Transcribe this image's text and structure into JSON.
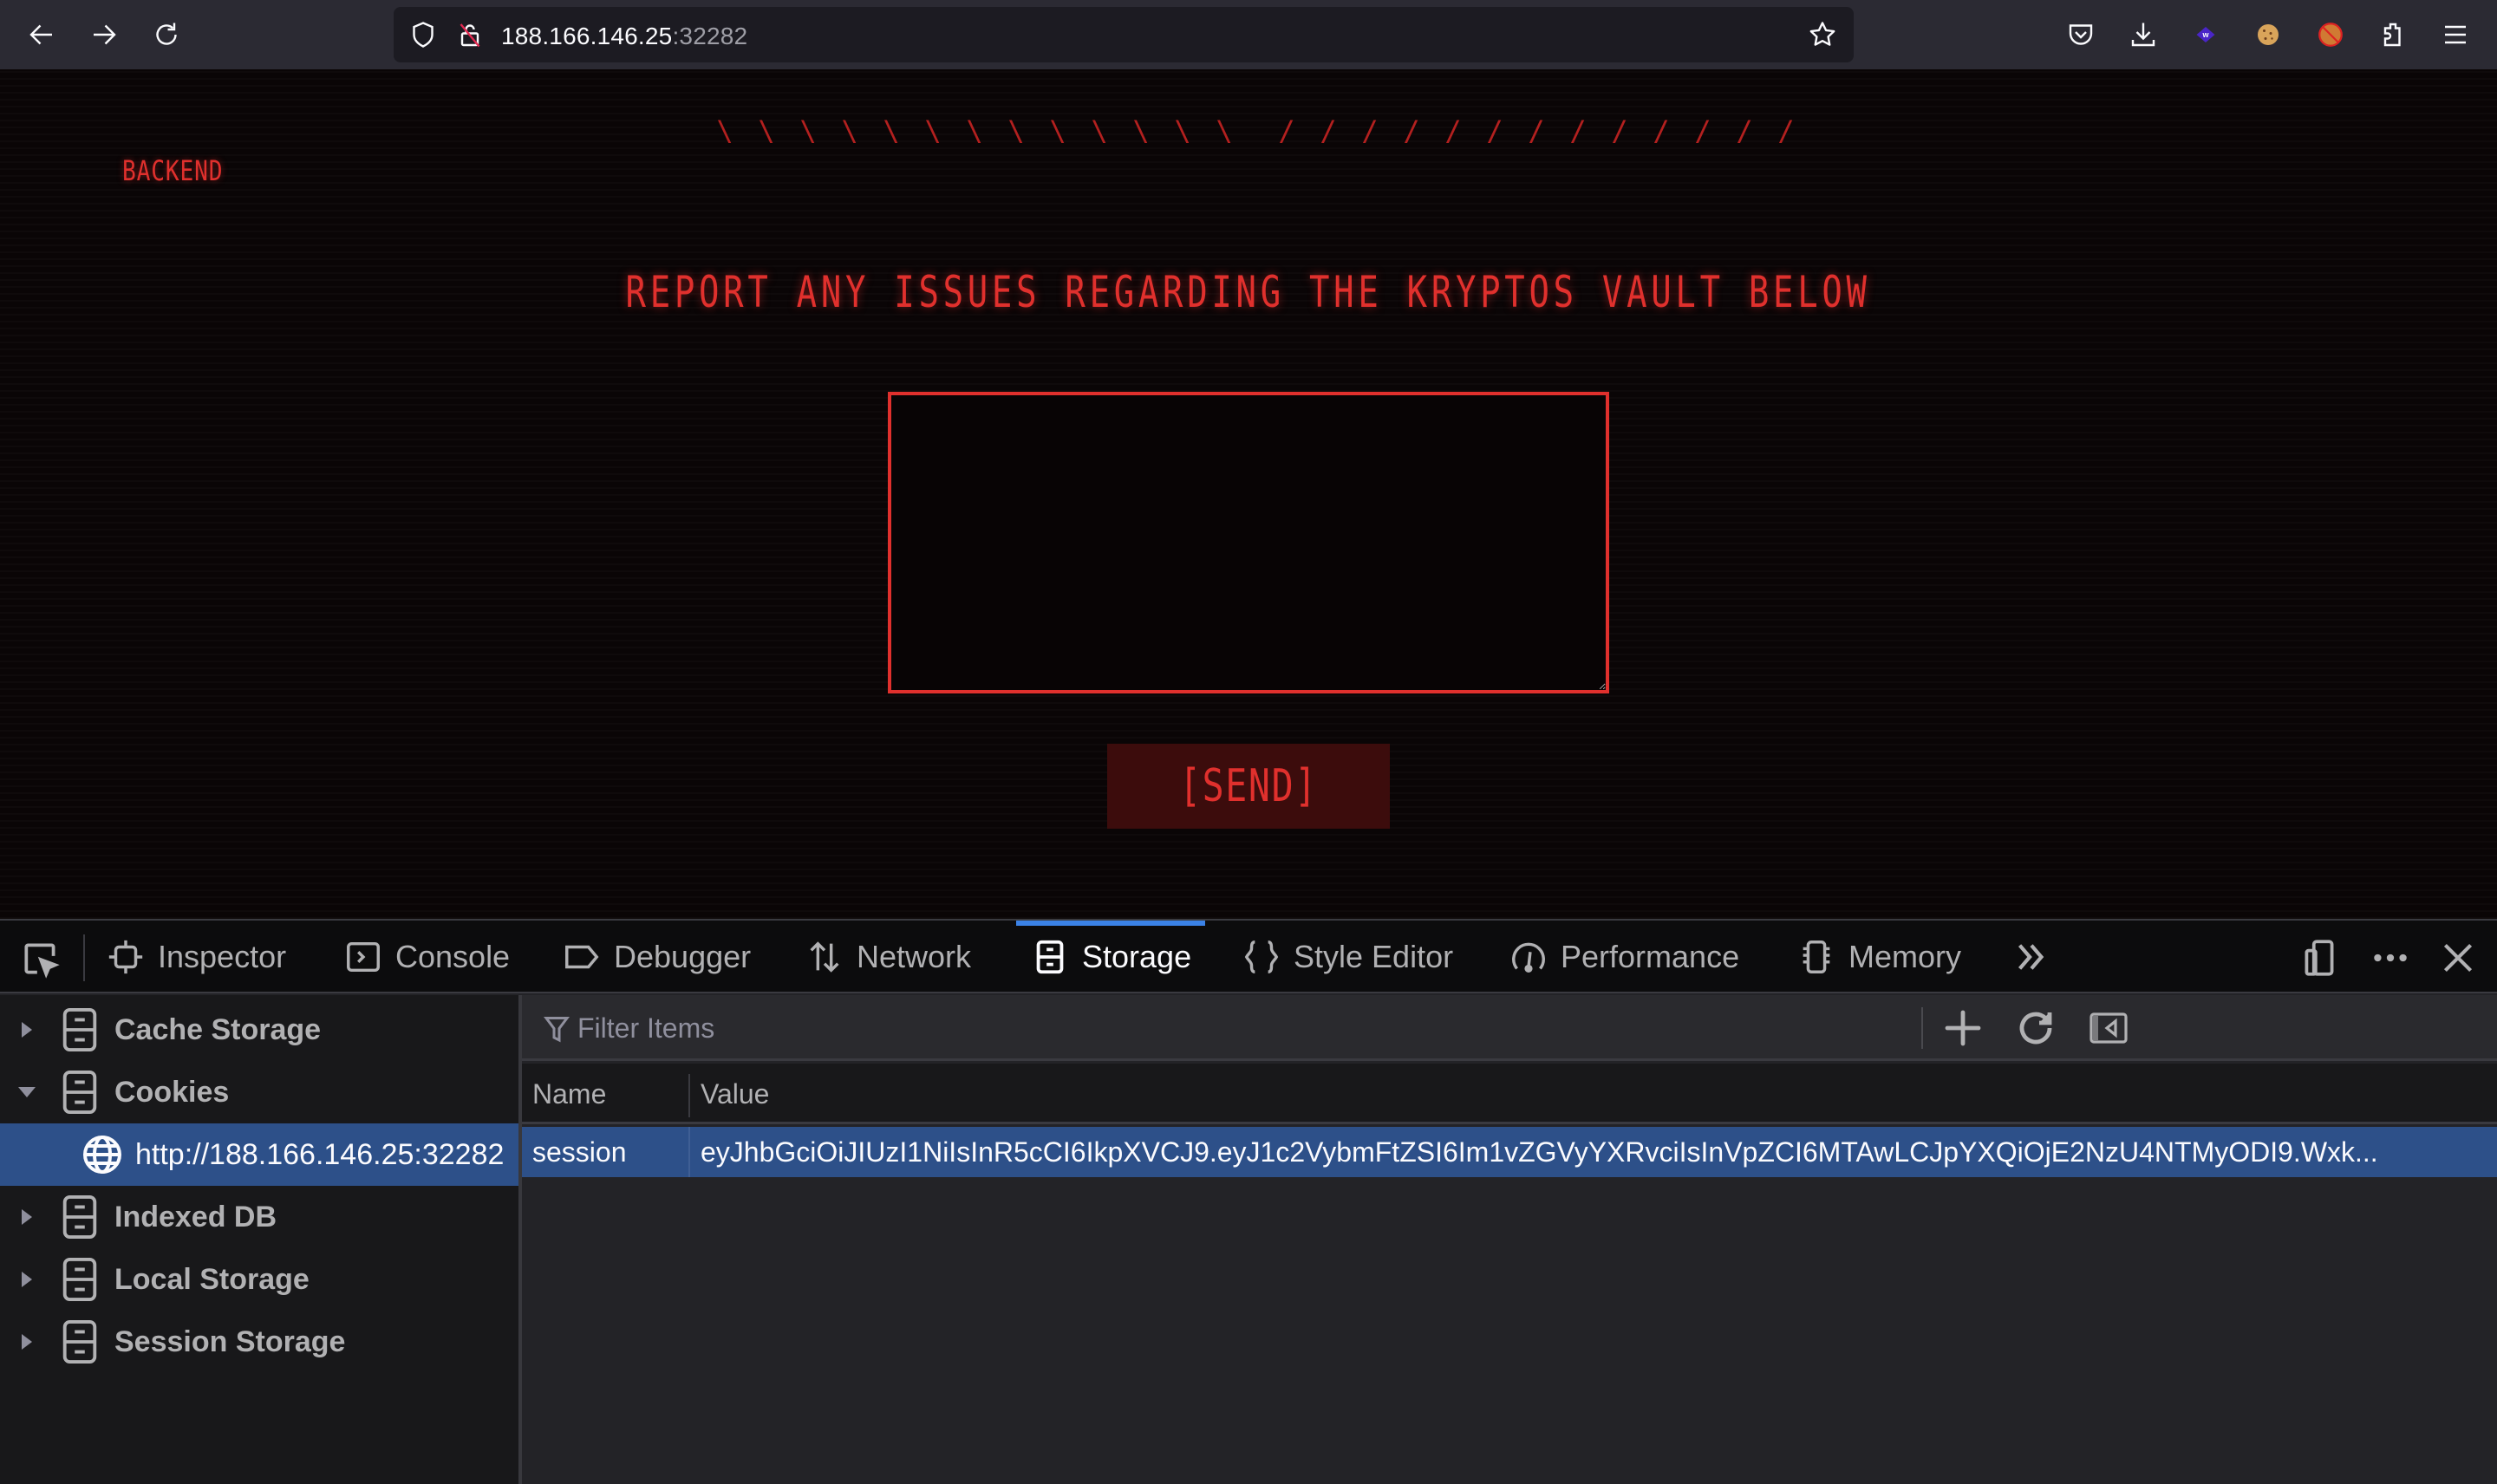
{
  "browser": {
    "url_host": "188.166.146.25",
    "url_port": ":32282",
    "nav": {
      "back": "back-arrow-icon",
      "forward": "forward-arrow-icon",
      "reload": "reload-icon"
    },
    "urlbar_icons": [
      "tracking-shield-icon",
      "insecure-lock-icon",
      "bookmark-star-icon"
    ],
    "extensions": [
      "pocket-icon",
      "downloads-icon",
      "wappalyzer-icon",
      "cookie-editor-icon",
      "foxyproxy-icon",
      "extensions-puzzle-icon",
      "hamburger-menu-icon"
    ]
  },
  "page": {
    "brand": "BACKEND",
    "slashes_left": [
      "\\",
      "\\",
      "\\",
      "\\",
      "\\",
      "\\",
      "\\",
      "\\",
      "\\",
      "\\",
      "\\",
      "\\",
      "\\"
    ],
    "slashes_right": [
      "/",
      "/",
      "/",
      "/",
      "/",
      "/",
      "/",
      "/",
      "/",
      "/",
      "/",
      "/",
      "/"
    ],
    "headline": "REPORT ANY ISSUES REGARDING THE KRYPTOS VAULT BELOW",
    "report_value": "",
    "send_label": "[SEND]",
    "accent_color": "#e0302d"
  },
  "devtools": {
    "tabs": [
      {
        "label": "Inspector",
        "icon": "inspector-icon"
      },
      {
        "label": "Console",
        "icon": "console-icon"
      },
      {
        "label": "Debugger",
        "icon": "debugger-icon"
      },
      {
        "label": "Network",
        "icon": "network-icon"
      },
      {
        "label": "Storage",
        "icon": "storage-icon",
        "active": true
      },
      {
        "label": "Style Editor",
        "icon": "style-editor-icon"
      },
      {
        "label": "Performance",
        "icon": "performance-icon"
      },
      {
        "label": "Memory",
        "icon": "memory-icon"
      }
    ],
    "sidebar": {
      "items": [
        {
          "label": "Cache Storage",
          "expanded": false
        },
        {
          "label": "Cookies",
          "expanded": true
        },
        {
          "label": "http://188.166.146.25:32282",
          "selected": true
        },
        {
          "label": "Indexed DB",
          "expanded": false
        },
        {
          "label": "Local Storage",
          "expanded": false
        },
        {
          "label": "Session Storage",
          "expanded": false
        }
      ]
    },
    "filter": {
      "placeholder": "Filter Items",
      "value": ""
    },
    "table": {
      "columns": [
        "Name",
        "Value"
      ],
      "rows": [
        {
          "name": "session",
          "value": "eyJhbGciOiJIUzI1NiIsInR5cCI6IkpXVCJ9.eyJ1c2VybmFtZSI6Im1vZGVyYXRvciIsInVpZCI6MTAwLCJpYXQiOjE2NzU4NTMyODI9.Wxk..."
        }
      ]
    },
    "selection_color": "#2d5089",
    "active_tab_color": "#3b82e6"
  }
}
